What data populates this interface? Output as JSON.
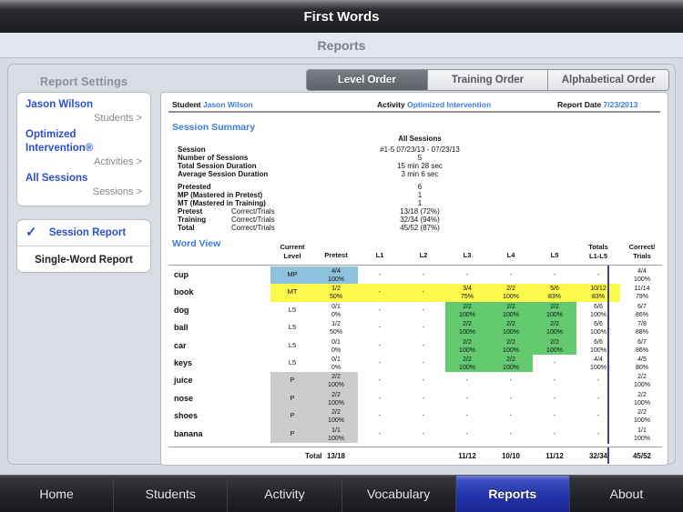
{
  "app": {
    "title": "First Words",
    "subheader": "Reports"
  },
  "settings_panel": {
    "heading": "Report Settings",
    "info": [
      {
        "title": "Jason Wilson",
        "sub": "Students >"
      },
      {
        "title": "Optimized Intervention®",
        "sub": "Activities >"
      },
      {
        "title": "All Sessions",
        "sub": "Sessions >"
      }
    ],
    "report_types": [
      {
        "label": "Session Report",
        "selected": true,
        "check": "✓"
      },
      {
        "label": "Single-Word Report",
        "selected": false,
        "check": ""
      }
    ]
  },
  "order_tabs": [
    {
      "label": "Level Order",
      "active": true
    },
    {
      "label": "Training Order",
      "active": false
    },
    {
      "label": "Alphabetical Order",
      "active": false
    }
  ],
  "report": {
    "meta": [
      {
        "key": "Student",
        "value": "Jason Wilson"
      },
      {
        "key": "Activity",
        "value": "Optimized Intervention"
      },
      {
        "key": "Report Date",
        "value": "7/23/2013"
      }
    ],
    "session_summary": {
      "heading": "Session Summary",
      "column_header": "All Sessions",
      "rows": [
        {
          "label": "Session",
          "sublabel": "",
          "value": "#1-5 07/23/13 - 07/23/13"
        },
        {
          "label": "Number of Sessions",
          "sublabel": "",
          "value": "5"
        },
        {
          "label": "Total Session Duration",
          "sublabel": "",
          "value": "15 min 28 sec"
        },
        {
          "label": "Average Session Duration",
          "sublabel": "",
          "value": "3 min 6 sec"
        },
        {
          "label": "Pretested",
          "sublabel": "",
          "value": "6"
        },
        {
          "label": "MP (Mastered in Pretest)",
          "sublabel": "",
          "value": "1"
        },
        {
          "label": "MT (Mastered in Training)",
          "sublabel": "",
          "value": "1"
        },
        {
          "label": "Pretest",
          "sublabel": "Correct/Trials",
          "value": "13/18 (72%)"
        },
        {
          "label": "Training",
          "sublabel": "Correct/Trials",
          "value": "32/34 (94%)"
        },
        {
          "label": "Total",
          "sublabel": "Correct/Trials",
          "value": "45/52 (87%)"
        }
      ]
    },
    "word_view": {
      "heading": "Word View",
      "columns": [
        "Current Level",
        "Pretest",
        "L1",
        "L2",
        "L3",
        "L4",
        "L5",
        "Totals L1-L5",
        "Correct/ Trials"
      ],
      "rows": [
        {
          "word": "cup",
          "level": "MP",
          "pretest": [
            "4/4",
            "100%"
          ],
          "l1": "-",
          "l2": "-",
          "l3": "-",
          "l4": "-",
          "l5": "-",
          "totals": "-",
          "correct": [
            "4/4",
            "100%"
          ]
        },
        {
          "word": "book",
          "level": "MT",
          "pretest": [
            "1/2",
            "50%"
          ],
          "l1": "-",
          "l2": "-",
          "l3": [
            "3/4",
            "75%"
          ],
          "l4": [
            "2/2",
            "100%"
          ],
          "l5": [
            "5/6",
            "83%"
          ],
          "totals": [
            "10/12",
            "83%"
          ],
          "correct": [
            "11/14",
            "79%"
          ]
        },
        {
          "word": "dog",
          "level": "L5",
          "pretest": [
            "0/1",
            "0%"
          ],
          "l1": "-",
          "l2": "-",
          "l3": [
            "2/2",
            "100%"
          ],
          "l4": [
            "2/2",
            "100%"
          ],
          "l5": [
            "2/2",
            "100%"
          ],
          "totals": [
            "6/6",
            "100%"
          ],
          "correct": [
            "6/7",
            "86%"
          ]
        },
        {
          "word": "ball",
          "level": "L5",
          "pretest": [
            "1/2",
            "50%"
          ],
          "l1": "-",
          "l2": "-",
          "l3": [
            "2/2",
            "100%"
          ],
          "l4": [
            "2/2",
            "100%"
          ],
          "l5": [
            "2/2",
            "100%"
          ],
          "totals": [
            "6/6",
            "100%"
          ],
          "correct": [
            "7/8",
            "88%"
          ]
        },
        {
          "word": "car",
          "level": "L5",
          "pretest": [
            "0/1",
            "0%"
          ],
          "l1": "-",
          "l2": "-",
          "l3": [
            "2/2",
            "100%"
          ],
          "l4": [
            "2/2",
            "100%"
          ],
          "l5": [
            "2/2",
            "100%"
          ],
          "totals": [
            "6/6",
            "100%"
          ],
          "correct": [
            "6/7",
            "86%"
          ]
        },
        {
          "word": "keys",
          "level": "L5",
          "pretest": [
            "0/1",
            "0%"
          ],
          "l1": "-",
          "l2": "-",
          "l3": [
            "2/2",
            "100%"
          ],
          "l4": [
            "2/2",
            "100%"
          ],
          "l5": "-",
          "totals": [
            "4/4",
            "100%"
          ],
          "correct": [
            "4/5",
            "80%"
          ]
        },
        {
          "word": "juice",
          "level": "P",
          "pretest": [
            "2/2",
            "100%"
          ],
          "l1": "-",
          "l2": "-",
          "l3": "-",
          "l4": "-",
          "l5": "-",
          "totals": "-",
          "correct": [
            "2/2",
            "100%"
          ]
        },
        {
          "word": "nose",
          "level": "P",
          "pretest": [
            "2/2",
            "100%"
          ],
          "l1": "-",
          "l2": "-",
          "l3": "-",
          "l4": "-",
          "l5": "-",
          "totals": "-",
          "correct": [
            "2/2",
            "100%"
          ]
        },
        {
          "word": "shoes",
          "level": "P",
          "pretest": [
            "2/2",
            "100%"
          ],
          "l1": "-",
          "l2": "-",
          "l3": "-",
          "l4": "-",
          "l5": "-",
          "totals": "-",
          "correct": [
            "2/2",
            "100%"
          ]
        },
        {
          "word": "banana",
          "level": "P",
          "pretest": [
            "1/1",
            "100%"
          ],
          "l1": "-",
          "l2": "-",
          "l3": "-",
          "l4": "-",
          "l5": "-",
          "totals": "-",
          "correct": [
            "1/1",
            "100%"
          ]
        }
      ],
      "total_row": {
        "label": "Total",
        "pretest": "13/18",
        "l1": "",
        "l2": "",
        "l3": "11/12",
        "l4": "10/10",
        "l5": "11/12",
        "totals": "32/34",
        "correct": "45/52"
      },
      "highlight_colors": {
        "mastered_pretest": "#8cc1dd",
        "mastered_training": "#fdf94c",
        "trained": "#63ca6f",
        "pretest_only": "#cccccc"
      }
    }
  },
  "tabbar": [
    {
      "label": "Home",
      "active": false
    },
    {
      "label": "Students",
      "active": false
    },
    {
      "label": "Activity",
      "active": false
    },
    {
      "label": "Vocabulary",
      "active": false
    },
    {
      "label": "Reports",
      "active": true
    },
    {
      "label": "About",
      "active": false
    }
  ]
}
